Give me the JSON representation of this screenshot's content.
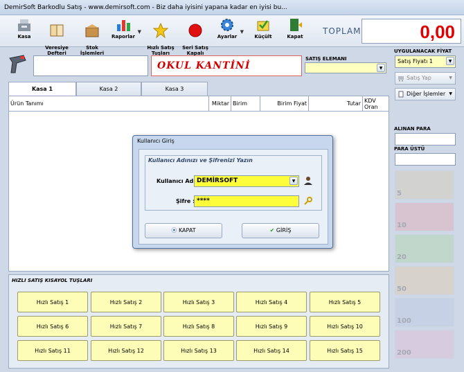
{
  "window": {
    "title": "DemirSoft Barkodlu Satış  -  www.demirsoft.com - Biz daha iyisini yapana kadar en iyisi bu..."
  },
  "toolbar": {
    "items": [
      {
        "label": "Kasa"
      },
      {
        "label": "Veresiye\nDefteri"
      },
      {
        "label": "Stok\nİşlemleri"
      },
      {
        "label": "Raporlar"
      },
      {
        "label": "Hızlı Satış\nTuşları"
      },
      {
        "label": "Seri Satış\nKapalı"
      },
      {
        "label": "Ayarlar"
      },
      {
        "label": "Küçült"
      },
      {
        "label": "Kapat"
      }
    ],
    "toplam_label": "TOPLAM :",
    "toplam_value": "0,00"
  },
  "sale": {
    "okul_name": "OKUL KANTİNİ",
    "satis_elemani_label": "SATIŞ ELEMANI",
    "satis_elemani_value": ""
  },
  "tabs": [
    {
      "label": "Kasa 1"
    },
    {
      "label": "Kasa 2"
    },
    {
      "label": "Kasa 3"
    }
  ],
  "grid": {
    "columns": [
      "Ürün Tanımı",
      "Miktar",
      "Birim",
      "Birim Fiyat",
      "Tutar",
      "KDV\nOran"
    ]
  },
  "quick": {
    "title": "HIZLI SATIŞ KISAYOL TUŞLARI",
    "buttons": [
      "Hızlı Satış 1",
      "Hızlı Satış 2",
      "Hızlı Satış 3",
      "Hızlı Satış 4",
      "Hızlı Satış 5",
      "Hızlı Satış 6",
      "Hızlı Satış 7",
      "Hızlı Satış 8",
      "Hızlı Satış 9",
      "Hızlı Satış 10",
      "Hızlı Satış 11",
      "Hızlı Satış 12",
      "Hızlı Satış 13",
      "Hızlı Satış 14",
      "Hızlı Satış 15"
    ]
  },
  "right": {
    "fiyat_label": "UYGULANACAK FİYAT",
    "fiyat_value": "Satış Fiyatı 1",
    "satis_yap": "Satış Yap",
    "diger": "Diğer İşlemler",
    "alinan_label": "ALINAN PARA",
    "para_ustu_label": "PARA ÜSTÜ",
    "notes": [
      "5",
      "10",
      "20",
      "50",
      "100",
      "200"
    ]
  },
  "dialog": {
    "title": "Kullanıcı Giriş",
    "group_title": "Kullanıcı Adınızı ve Şifrenizi Yazın",
    "user_label": "Kullanıcı Adı :",
    "user_value": "DEMİRSOFT",
    "pass_label": "Şifre :",
    "pass_value": "****",
    "kapat": "KAPAT",
    "giris": "GİRİŞ"
  },
  "colors": {
    "toplam": "#e00000",
    "okul": "#d00000",
    "field_yellow": "#fdfd3c",
    "quick_button": "#fdfdb8"
  }
}
